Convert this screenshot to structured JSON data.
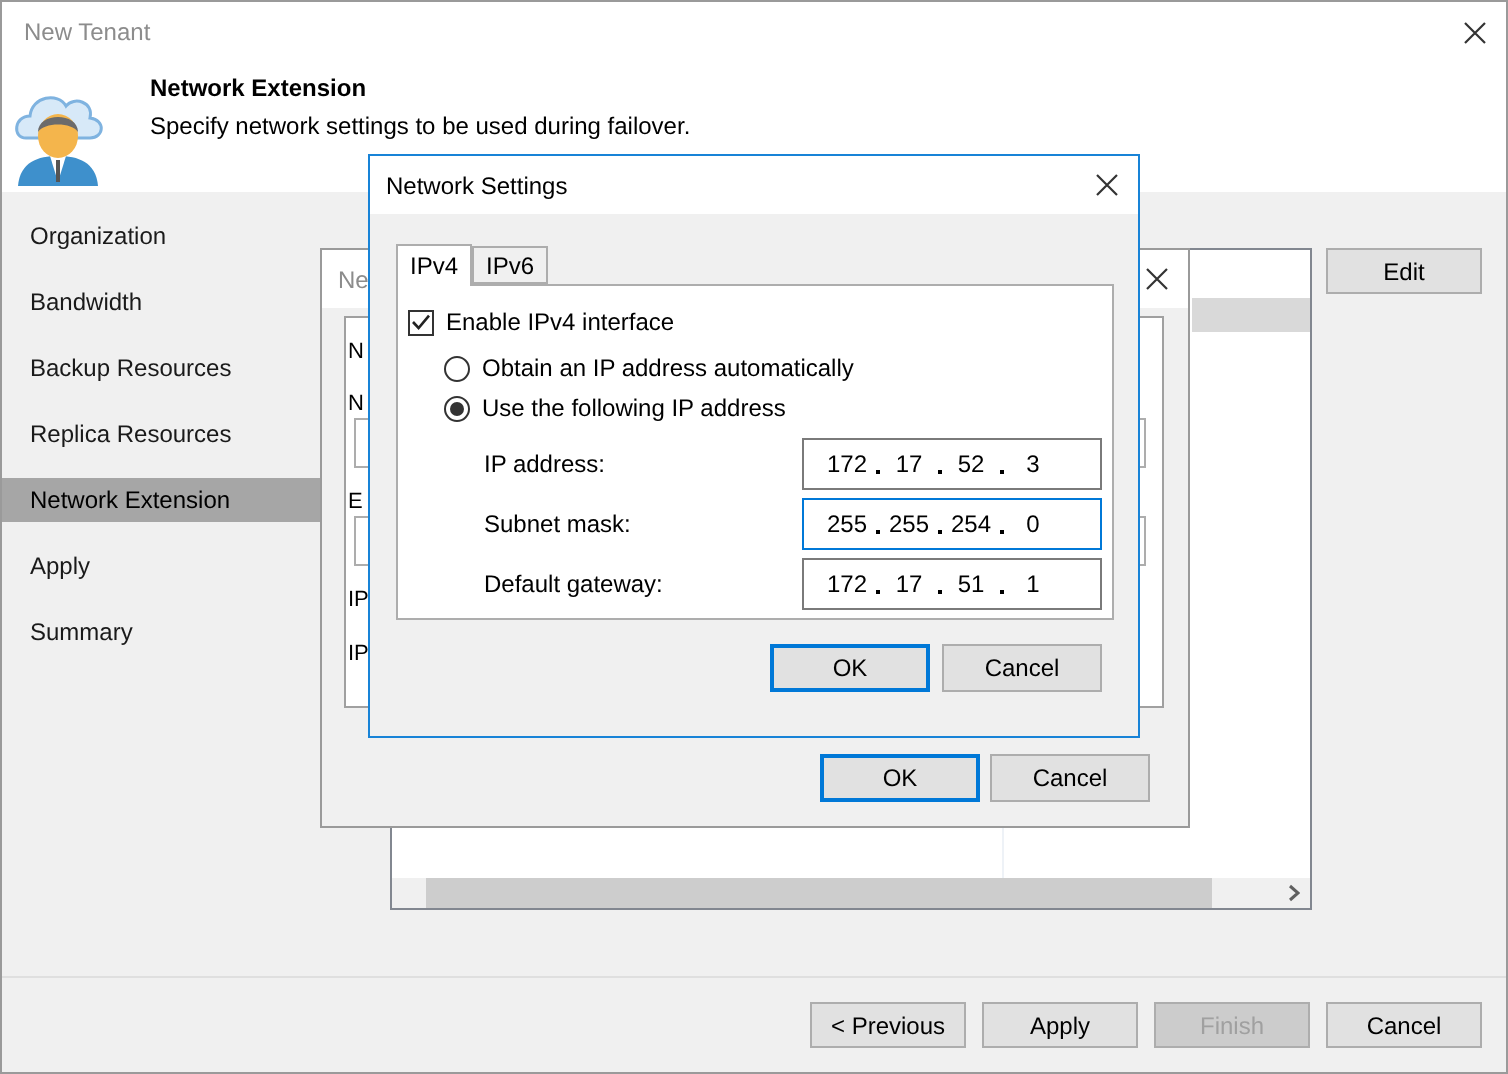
{
  "window": {
    "title": "New Tenant"
  },
  "header": {
    "title": "Network Extension",
    "subtitle": "Specify network settings to be used during failover."
  },
  "steps": [
    {
      "label": "Organization",
      "selected": false
    },
    {
      "label": "Bandwidth",
      "selected": false
    },
    {
      "label": "Backup Resources",
      "selected": false
    },
    {
      "label": "Replica Resources",
      "selected": false
    },
    {
      "label": "Network Extension",
      "selected": true
    },
    {
      "label": "Apply",
      "selected": false
    },
    {
      "label": "Summary",
      "selected": false
    }
  ],
  "content": {
    "edit_button": "Edit"
  },
  "footer_buttons": [
    {
      "label": "< Previous",
      "disabled": false
    },
    {
      "label": "Apply",
      "disabled": false
    },
    {
      "label": "Finish",
      "disabled": true
    },
    {
      "label": "Cancel",
      "disabled": false
    }
  ],
  "behind_dialog": {
    "title": "Ne",
    "labels": [
      "N",
      "N",
      "E",
      "IP",
      "IP"
    ],
    "buttons": [
      {
        "label": "OK",
        "default": true
      },
      {
        "label": "Cancel",
        "default": false
      }
    ]
  },
  "network_settings": {
    "title": "Network Settings",
    "tabs": [
      {
        "label": "IPv4",
        "selected": true
      },
      {
        "label": "IPv6",
        "selected": false
      }
    ],
    "enable": {
      "label": "Enable IPv4 interface",
      "checked": true
    },
    "options": [
      {
        "label": "Obtain an IP address automatically",
        "selected": false
      },
      {
        "label": "Use the following IP address",
        "selected": true
      }
    ],
    "fields": [
      {
        "label": "IP address:",
        "octets": [
          "172",
          "17",
          "52",
          "3"
        ],
        "focused": false
      },
      {
        "label": "Subnet mask:",
        "octets": [
          "255",
          "255",
          "254",
          "0"
        ],
        "focused": true
      },
      {
        "label": "Default gateway:",
        "octets": [
          "172",
          "17",
          "51",
          "1"
        ],
        "focused": false
      }
    ],
    "buttons": [
      {
        "label": "OK",
        "default": true
      },
      {
        "label": "Cancel",
        "default": false
      }
    ]
  }
}
